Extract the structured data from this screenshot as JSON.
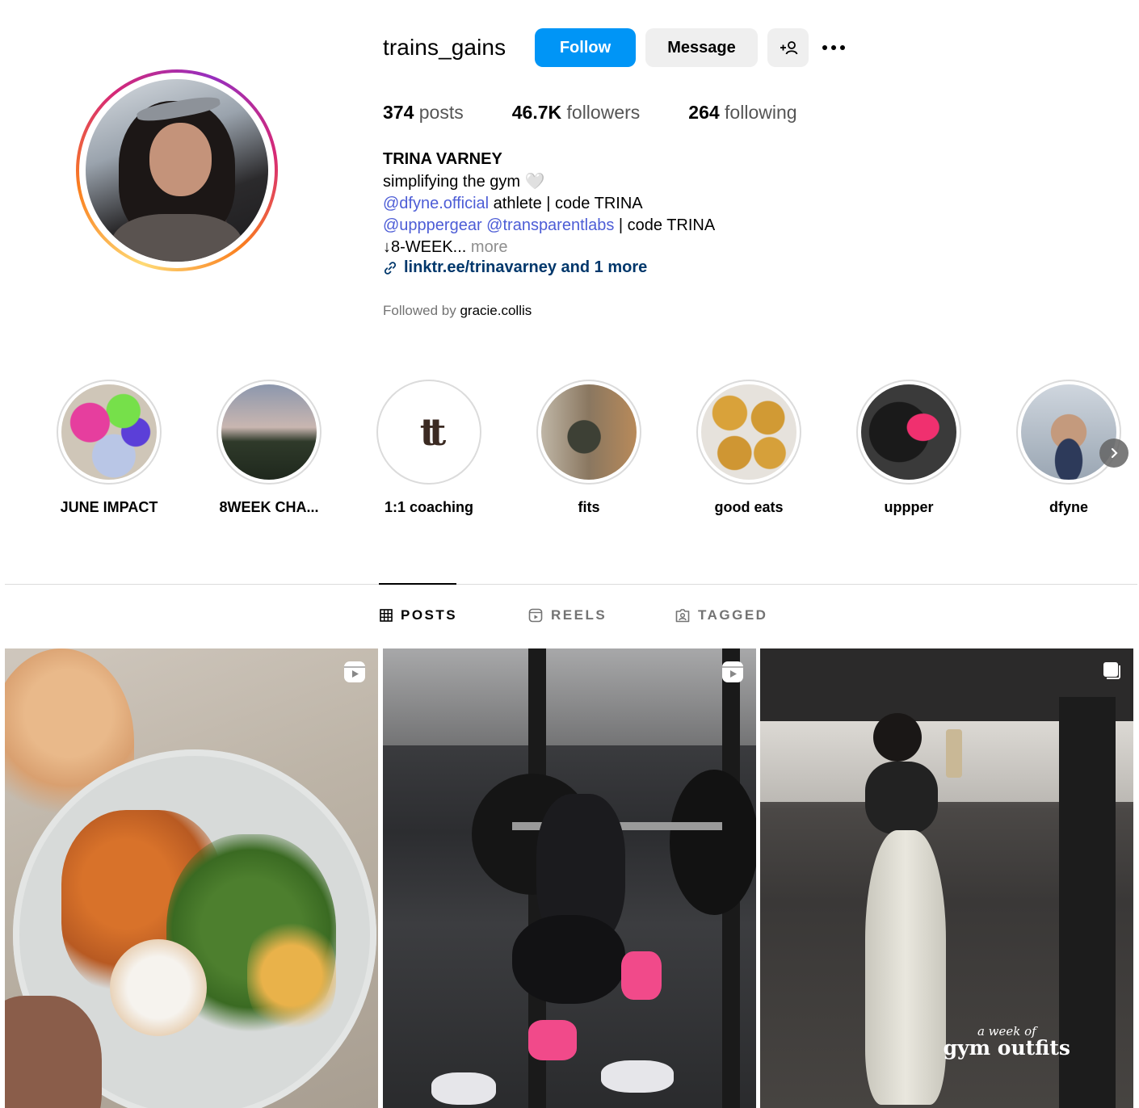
{
  "profile": {
    "username": "trains_gains",
    "follow_label": "Follow",
    "message_label": "Message",
    "posts_count": "374",
    "posts_label": "posts",
    "followers_count": "46.7K",
    "followers_label": "followers",
    "following_count": "264",
    "following_label": "following",
    "full_name": "TRINA VARNEY",
    "bio_line1": "simplifying the gym",
    "bio_heart": "🤍",
    "bio_line2_mention": "@dfyne.official",
    "bio_line2_rest": " athlete | code TRINA",
    "bio_line3_mention1": "@upppergear",
    "bio_line3_mention2": "@transparentlabs",
    "bio_line3_rest": " | code TRINA",
    "bio_line4": "↓8-WEEK...",
    "bio_more": "more",
    "link_text": "linktr.ee/trinavarney and 1 more",
    "followed_by_prefix": "Followed by",
    "followed_by_user": "gracie.collis"
  },
  "highlights": [
    {
      "label": "JUNE IMPACT"
    },
    {
      "label": "8WEEK CHA..."
    },
    {
      "label": "1:1 coaching"
    },
    {
      "label": "fits"
    },
    {
      "label": "good eats"
    },
    {
      "label": "uppper"
    },
    {
      "label": "dfyne"
    }
  ],
  "tabs": {
    "posts": "POSTS",
    "reels": "REELS",
    "tagged": "TAGGED",
    "active": "posts"
  },
  "posts": [
    {
      "type": "reel"
    },
    {
      "type": "reel"
    },
    {
      "type": "carousel",
      "overlay_small": "a week of",
      "overlay_big": "gym outfits"
    }
  ],
  "colors": {
    "follow_button": "#0095f6",
    "secondary_button": "#efefef",
    "mention": "#4d5dd6",
    "link": "#00376b"
  }
}
